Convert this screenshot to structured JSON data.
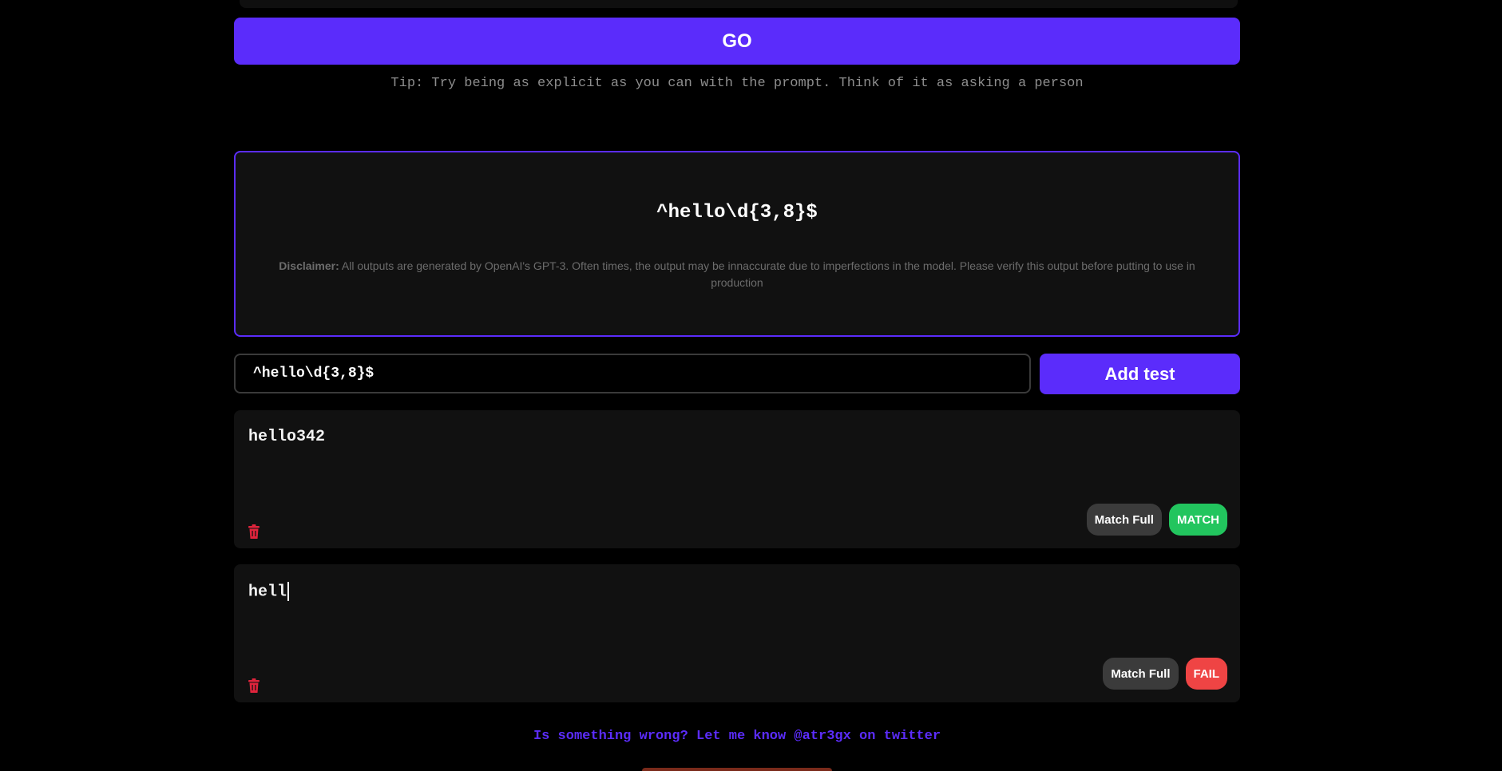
{
  "go_button": {
    "label": "GO"
  },
  "tip": "Tip: Try being as explicit as you can with the prompt. Think of it as asking a person",
  "result": {
    "regex": "^hello\\d{3,8}$",
    "disclaimer_label": "Disclaimer:",
    "disclaimer_text": " All outputs are generated by OpenAI's GPT-3. Often times, the output may be innaccurate due to imperfections in the model. Please verify this output before putting to use in production"
  },
  "regex_input": {
    "value": "^hello\\d{3,8}$"
  },
  "add_test_button": {
    "label": "Add test"
  },
  "tests": [
    {
      "text": "hello342",
      "mode_label": "Match Full",
      "status_label": "MATCH"
    },
    {
      "text": "hell",
      "mode_label": "Match Full",
      "status_label": "FAIL"
    }
  ],
  "footer": {
    "link_text": "Is something wrong? Let me know @atr3gx on twitter"
  },
  "colors": {
    "accent": "#5b2cfb",
    "match": "#22c55e",
    "fail": "#ef4444",
    "trash": "#e0243c"
  }
}
